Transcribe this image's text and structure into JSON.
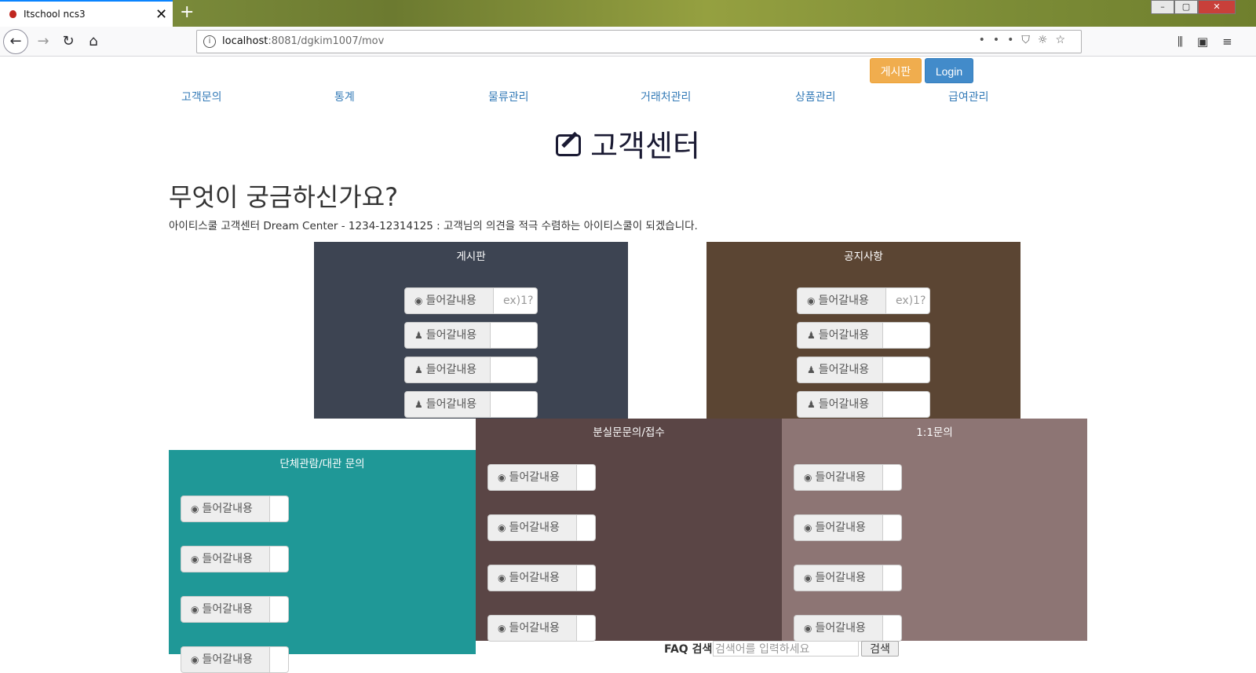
{
  "browser": {
    "tab_title": "Itschool ncs3",
    "tab_close": "✕",
    "new_tab": "+",
    "url_host": "localhost",
    "url_rest": ":8081/dgkim1007/mov",
    "window_min": "–",
    "window_max": "▢",
    "window_close": "✕"
  },
  "topnav": {
    "board_button": "게시판",
    "login_button": "Login",
    "menu": [
      "고객문의",
      "통계",
      "물류관리",
      "거래처관리",
      "상품관리",
      "급여관리"
    ]
  },
  "page": {
    "heading": "고객센터",
    "question": "무엇이 궁금하신가요?",
    "description": "아이티스쿨 고객센터 Dream Center - 1234-12314125 : 고객님의 의견을 적극 수렴하는 아이티스쿨이 되겠습니다."
  },
  "panels": {
    "board": {
      "title": "게시판",
      "rows": [
        {
          "label": "들어갈내용",
          "icon": "user-circle-icon",
          "placeholder": "ex)1?"
        },
        {
          "label": "들어갈내용",
          "icon": "user-icon",
          "placeholder": ""
        },
        {
          "label": "들어갈내용",
          "icon": "user-icon",
          "placeholder": ""
        },
        {
          "label": "들어갈내용",
          "icon": "user-icon",
          "placeholder": ""
        }
      ]
    },
    "notice": {
      "title": "공지사항",
      "rows": [
        {
          "label": "들어갈내용",
          "icon": "user-circle-icon",
          "placeholder": "ex)1?"
        },
        {
          "label": "들어갈내용",
          "icon": "user-icon",
          "placeholder": ""
        },
        {
          "label": "들어갈내용",
          "icon": "user-icon",
          "placeholder": ""
        },
        {
          "label": "들어갈내용",
          "icon": "user-icon",
          "placeholder": ""
        }
      ]
    },
    "group": {
      "title": "단체관람/대관 문의",
      "rows": [
        {
          "label": "들어갈내용",
          "icon": "user-circle-icon"
        },
        {
          "label": "들어갈내용",
          "icon": "user-circle-icon"
        },
        {
          "label": "들어갈내용",
          "icon": "user-circle-icon"
        },
        {
          "label": "들어갈내용",
          "icon": "user-circle-icon"
        }
      ]
    },
    "lost": {
      "title": "분실문문의/접수",
      "rows": [
        {
          "label": "들어갈내용",
          "icon": "user-circle-icon"
        },
        {
          "label": "들어갈내용",
          "icon": "user-circle-icon"
        },
        {
          "label": "들어갈내용",
          "icon": "user-circle-icon"
        },
        {
          "label": "들어갈내용",
          "icon": "user-circle-icon"
        }
      ]
    },
    "oneone": {
      "title": "1:1문의",
      "rows": [
        {
          "label": "들어갈내용",
          "icon": "user-circle-icon"
        },
        {
          "label": "들어갈내용",
          "icon": "user-circle-icon"
        },
        {
          "label": "들어갈내용",
          "icon": "user-circle-icon"
        },
        {
          "label": "들어갈내용",
          "icon": "user-circle-icon"
        }
      ]
    }
  },
  "faq": {
    "label": "FAQ 검색",
    "placeholder": "검색어를 입력하세요",
    "button": "검색"
  },
  "colors": {
    "board_panel": "#3d4452",
    "notice_panel": "#5b4533",
    "group_panel": "#1f9897",
    "lost_panel": "#5a4545",
    "oneone_panel": "#8d7574",
    "link": "#337ab7",
    "warning_button": "#f0ad4e",
    "primary_button": "#428bca"
  }
}
